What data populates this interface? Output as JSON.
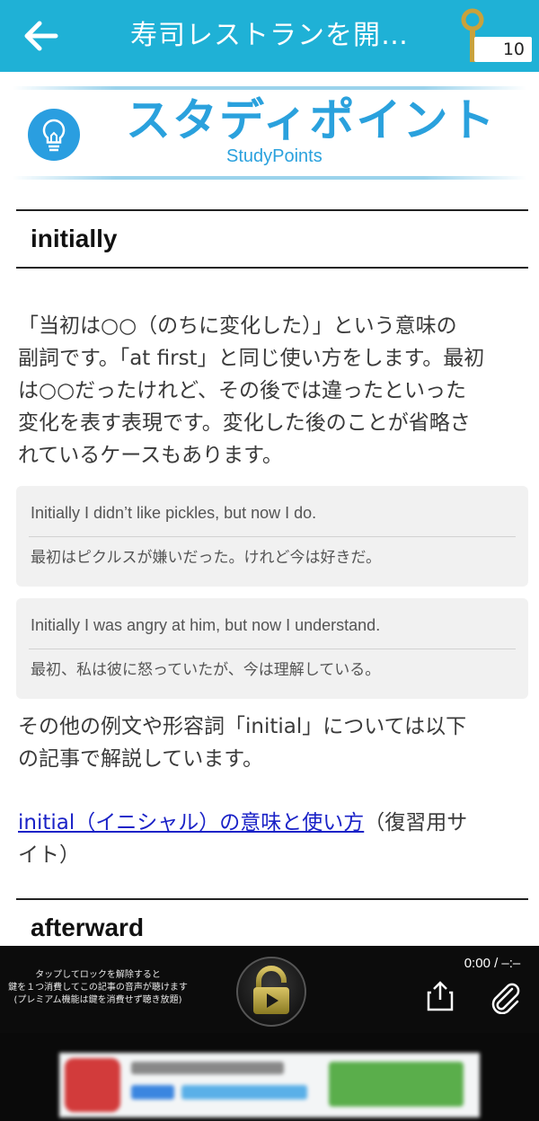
{
  "header": {
    "title": "寿司レストランを開…",
    "key_count": "10"
  },
  "banner": {
    "title": "スタディポイント",
    "subtitle": "StudyPoints"
  },
  "section1": {
    "heading": "initially",
    "paragraph_lines": [
      "「当初は○○（のちに変化した）」という意味の",
      "副詞です。「at first」と同じ使い方をします。最初",
      "は○○だったけれど、その後では違ったといった",
      "変化を表す表現です。変化した後のことが省略さ",
      "れているケースもあります。"
    ],
    "examples": [
      {
        "en": "Initially I didn’t like pickles, but now I do.",
        "jp": "最初はピクルスが嫌いだった。けれど今は好きだ。"
      },
      {
        "en": "Initially I was angry at him, but now I understand.",
        "jp": "最初、私は彼に怒っていたが、今は理解している。"
      }
    ],
    "more_lines": [
      "その他の例文や形容詞「initial」については以下",
      "の記事で解説しています。"
    ],
    "link_text": "initial（イニシャル）の意味と使い方",
    "link_suffix_1": "（復習用サ",
    "link_suffix_2": "イト）"
  },
  "section2": {
    "heading": "afterward"
  },
  "player": {
    "note_lines": [
      "タップしてロックを解除すると",
      "鍵を１つ消費してこの記事の音声が聴けます",
      "(プレミアム機能は鍵を消費せず聴き放題)"
    ],
    "time": "0:00 / –:–"
  },
  "colors": {
    "header_bg": "#1fb1d6",
    "accent": "#2aa1dd",
    "link": "#1a22c7",
    "player_bg": "#0c0c0c"
  },
  "icons": {
    "back": "arrow-left-icon",
    "key": "key-icon",
    "bulb": "lightbulb-icon",
    "lock": "lock-play-icon",
    "share": "share-icon",
    "attach": "paperclip-icon"
  }
}
